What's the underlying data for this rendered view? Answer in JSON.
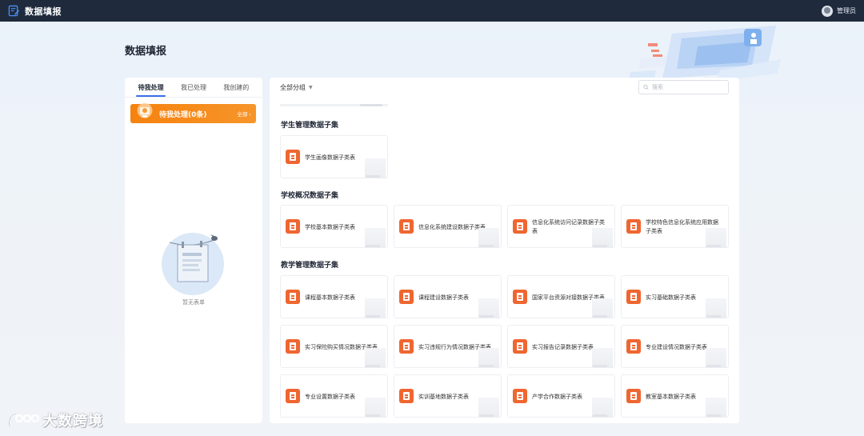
{
  "app": {
    "title": "数据填报",
    "user_name": "管理员"
  },
  "page": {
    "title": "数据填报"
  },
  "left_panel": {
    "tabs": [
      {
        "label": "待我处理",
        "active": true
      },
      {
        "label": "我已处理",
        "active": false
      },
      {
        "label": "我创建的",
        "active": false
      }
    ],
    "todo": {
      "title": "待我处理(0条)",
      "all_link": "全部 ›"
    },
    "empty_text": "暂无表单"
  },
  "right_panel": {
    "group_select": "全部分组",
    "search_placeholder": "搜索",
    "sections": [
      {
        "title": "学生管理数据子集",
        "cards": [
          "学生画像数据子类表"
        ]
      },
      {
        "title": "学校概况数据子集",
        "cards": [
          "学校基本数据子类表",
          "信息化系统建设数据子类表",
          "信息化系统访问记录数据子类表",
          "学校特色信息化系统应用数据子类表"
        ]
      },
      {
        "title": "教学管理数据子集",
        "cards": [
          "课程基本数据子类表",
          "课程建设数据子类表",
          "国家平台资源对接数据子类表",
          "实习基础数据子类表",
          "实习保险购买情况数据子类表",
          "实习违规行为情况数据子类表",
          "实习报告记录数据子类表",
          "专业建设情况数据子类表",
          "专业设置数据子类表",
          "实训基地数据子类表",
          "产学合作数据子类表",
          "教室基本数据子类表"
        ]
      }
    ]
  },
  "watermark": {
    "text": "大数跨境"
  },
  "colors": {
    "accent": "#3b6ee8",
    "topbar": "#1f2a3d",
    "orange": "#f5820f",
    "form_icon": "#ef6630"
  }
}
